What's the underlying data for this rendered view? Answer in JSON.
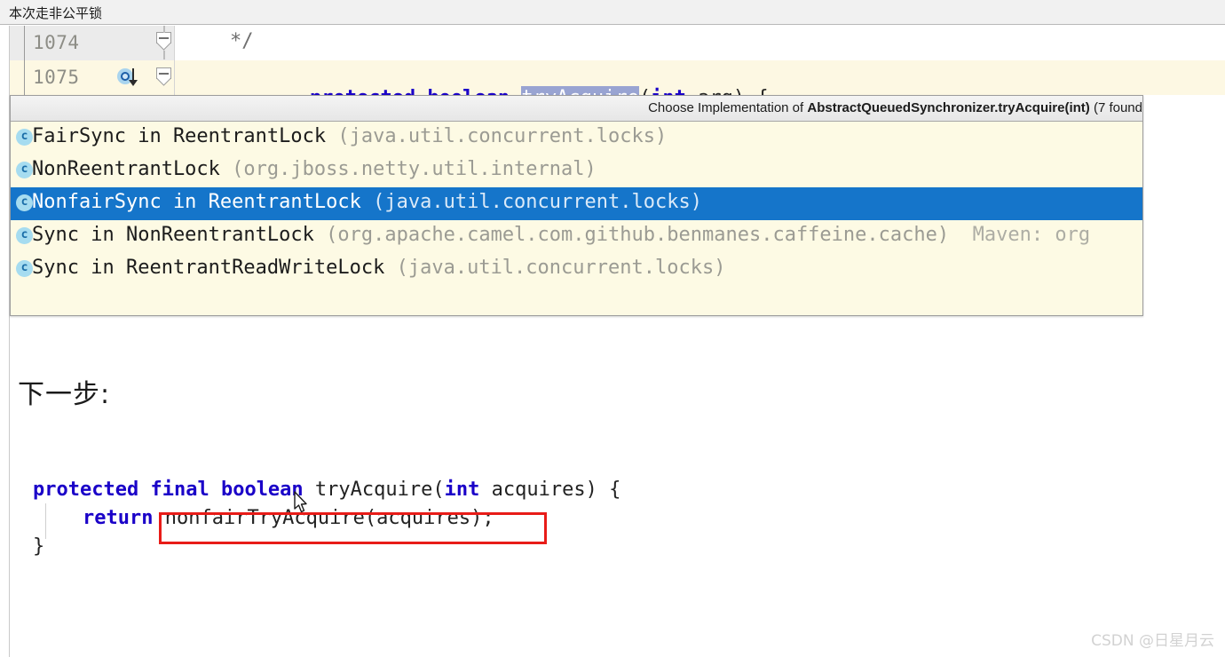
{
  "window": {
    "title": "本次走非公平锁"
  },
  "editor": {
    "lines": [
      {
        "number": "1074",
        "text": "*/",
        "style": "comment"
      },
      {
        "number": "1075",
        "text": "protected boolean tryAcquire(int arg) {",
        "style": "code"
      }
    ],
    "line_1074": {
      "number": "1074",
      "comment": "*/"
    },
    "line_1075": {
      "number": "1075",
      "kw_protected": "protected",
      "kw_boolean": "boolean",
      "selected_identifier": "tryAcquire",
      "open_paren": "(",
      "kw_int": "int",
      "param": " arg) {"
    },
    "gutter_icon": "override-method-icon",
    "fold_icon": "collapse-minus-icon"
  },
  "popup": {
    "header_prefix": "Choose Implementation of ",
    "header_target": "AbstractQueuedSynchronizer.tryAcquire(int)",
    "header_suffix": " (7 found",
    "items": [
      {
        "icon": "class-icon",
        "icon_letter": "c",
        "name": "FairSync in ReentrantLock",
        "package": " (java.util.concurrent.locks)",
        "extra": "",
        "selected": false
      },
      {
        "icon": "class-icon",
        "icon_letter": "c",
        "name": "NonReentrantLock",
        "package": " (org.jboss.netty.util.internal)",
        "extra": "",
        "selected": false
      },
      {
        "icon": "class-icon",
        "icon_letter": "c",
        "name": "NonfairSync in ReentrantLock",
        "package": " (java.util.concurrent.locks)",
        "extra": "",
        "selected": true
      },
      {
        "icon": "class-icon",
        "icon_letter": "c",
        "name": "Sync in NonReentrantLock",
        "package": " (org.apache.camel.com.github.benmanes.caffeine.cache)",
        "extra": "  Maven: org",
        "selected": false
      },
      {
        "icon": "class-icon",
        "icon_letter": "c",
        "name": "Sync in ReentrantReadWriteLock",
        "package": " (java.util.concurrent.locks)",
        "extra": "",
        "selected": false
      }
    ]
  },
  "annotation": {
    "next_step_label": "下一步:"
  },
  "snippet": {
    "line1": {
      "kw_protected": "protected",
      "kw_final": "final",
      "kw_boolean": "boolean",
      "method": " tryAcquire(",
      "kw_int": "int",
      "tail": " acquires) {"
    },
    "line2": {
      "kw_return": "return",
      "call": " nonfairTryAcquire(acquires);"
    },
    "line3": {
      "brace": "}"
    },
    "highlight_box_color": "#e81c18",
    "highlighted_text": "nonfairTryAcquire(acquires);"
  },
  "watermark": {
    "text": "CSDN @日星月云"
  },
  "colors": {
    "selected_row": "#1575ca",
    "popup_background": "#fdfae4",
    "current_line": "#fdf8e3",
    "keyword": "#1a00c8",
    "identifier_selection": "#99a4d2",
    "annotation_red": "#e81c18"
  }
}
